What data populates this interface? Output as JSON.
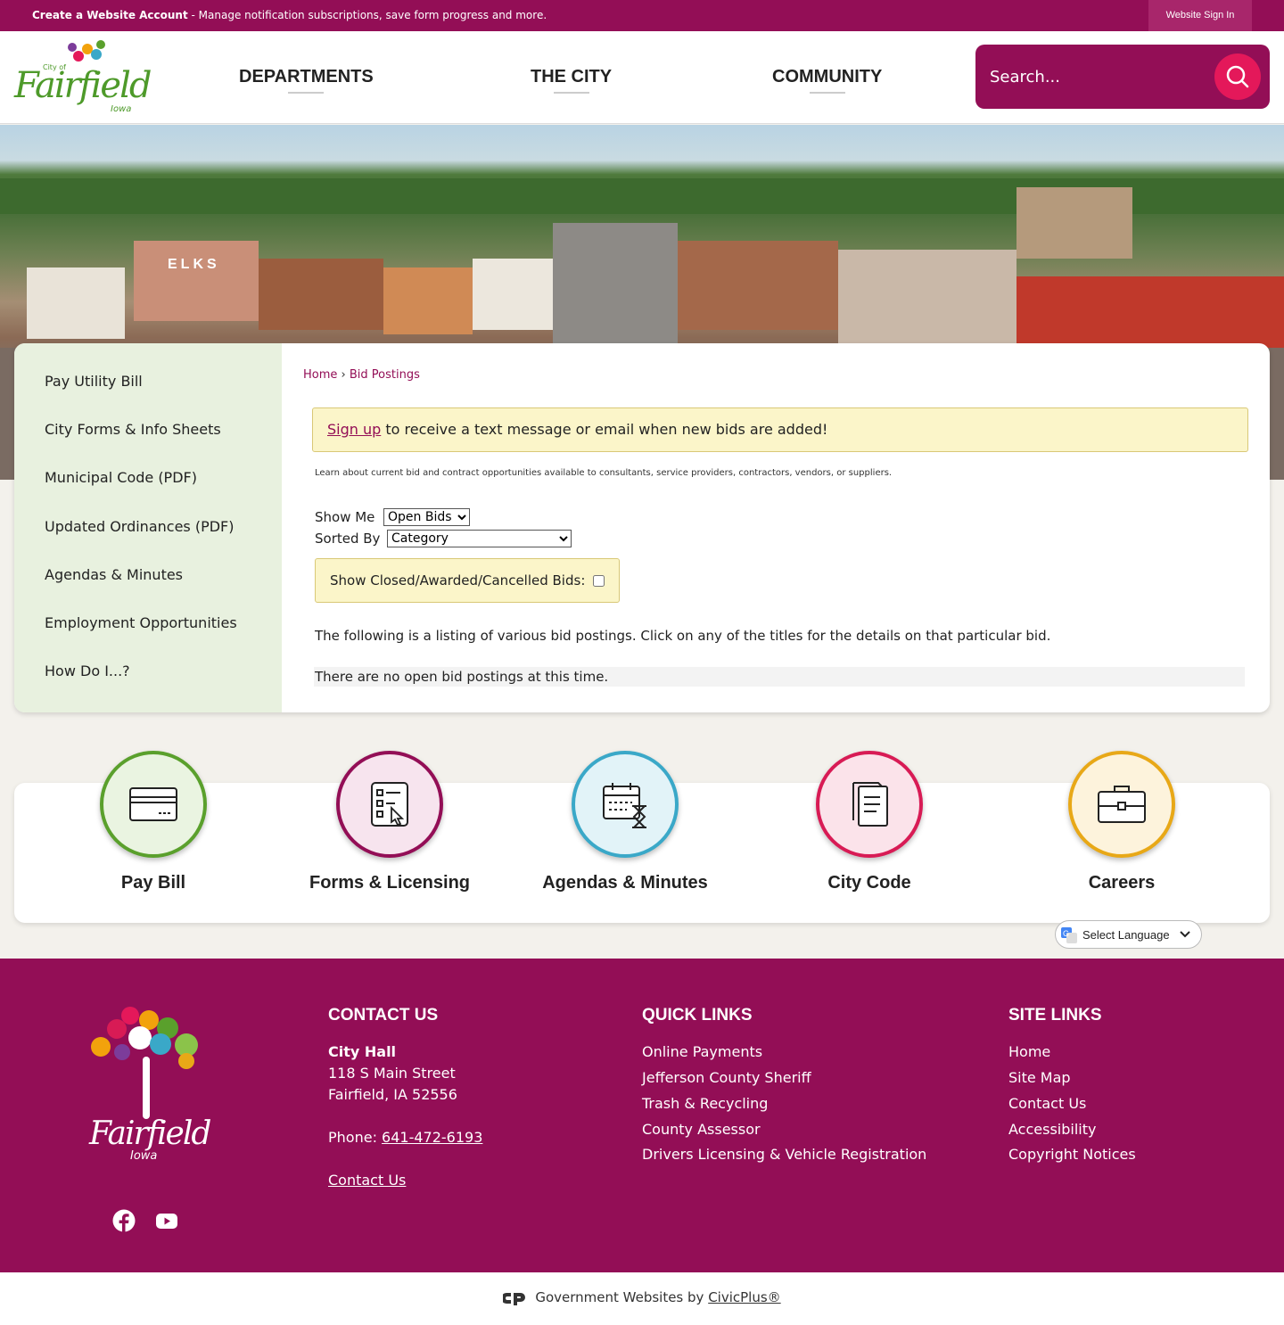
{
  "topbar": {
    "create_account": "Create a Website Account",
    "message": " - Manage notification subscriptions, save form progress and more.",
    "sign_in": "Website Sign In"
  },
  "header": {
    "logo_city_of": "City of",
    "logo_name": "Fairfield",
    "logo_state": "Iowa",
    "nav": [
      "DEPARTMENTS",
      "THE CITY",
      "COMMUNITY"
    ],
    "search_placeholder": "Search..."
  },
  "hero": {
    "sign": "ELKS"
  },
  "sidebar": {
    "items": [
      {
        "label": "Pay Utility Bill"
      },
      {
        "label": "City Forms & Info Sheets"
      },
      {
        "label": "Municipal Code (PDF)"
      },
      {
        "label": "Updated Ordinances (PDF)"
      },
      {
        "label": "Agendas & Minutes"
      },
      {
        "label": "Employment Opportunities"
      },
      {
        "label": "How Do I...?"
      }
    ]
  },
  "breadcrumb": {
    "home": "Home",
    "separator": "›",
    "current": "Bid Postings"
  },
  "main": {
    "alert_link": "Sign up",
    "alert_text": " to receive a text message or email when new bids are added!",
    "learn": "Learn about current bid and contract opportunities available to consultants, service providers, contractors, vendors, or suppliers.",
    "show_me_label": "Show Me",
    "show_me_value": "Open Bids",
    "sorted_by_label": "Sorted By",
    "sorted_by_value": "Category",
    "closed_label": "Show Closed/Awarded/Cancelled Bids:",
    "closed_checked": false,
    "listing_text": "The following is a listing of various bid postings. Click on any of the titles for the details on that particular bid.",
    "no_bids": "There are no open bid postings at this time."
  },
  "tiles": [
    {
      "label": "Pay Bill",
      "icon": "credit-card-icon",
      "color": "#5aa02c",
      "bg": "#eaf4e1"
    },
    {
      "label": "Forms & Licensing",
      "icon": "form-checklist-icon",
      "color": "#930e56",
      "bg": "#f7e4ee"
    },
    {
      "label": "Agendas & Minutes",
      "icon": "calendar-hourglass-icon",
      "color": "#3aa8c8",
      "bg": "#e2f3f8"
    },
    {
      "label": "City Code",
      "icon": "document-icon",
      "color": "#d81b55",
      "bg": "#fbe3ea"
    },
    {
      "label": "Careers",
      "icon": "briefcase-icon",
      "color": "#e8a817",
      "bg": "#fdf3dc"
    }
  ],
  "translate": {
    "label": "Select Language"
  },
  "footer": {
    "logo_name": "Fairfield",
    "logo_state": "Iowa",
    "contact": {
      "heading": "CONTACT US",
      "name": "City Hall",
      "street": "118 S Main Street",
      "city": "Fairfield, IA 52556",
      "phone_label": "Phone: ",
      "phone": "641-472-6193",
      "link": "Contact Us"
    },
    "quick_links": {
      "heading": "QUICK LINKS",
      "items": [
        "Online Payments",
        "Jefferson County Sheriff",
        "Trash & Recycling",
        "County Assessor",
        "Drivers Licensing & Vehicle Registration"
      ]
    },
    "site_links": {
      "heading": "SITE LINKS",
      "items": [
        "Home",
        "Site Map",
        "Contact Us",
        "Accessibility",
        "Copyright Notices"
      ]
    },
    "social": [
      "facebook-icon",
      "youtube-icon"
    ]
  },
  "bottom": {
    "prefix": "Government Websites by ",
    "link": "CivicPlus®"
  },
  "colors": {
    "brand": "#930e56",
    "accent": "#e4185a",
    "sidebar_bg": "#e8f1df",
    "alert_bg": "#fbf5c9"
  }
}
